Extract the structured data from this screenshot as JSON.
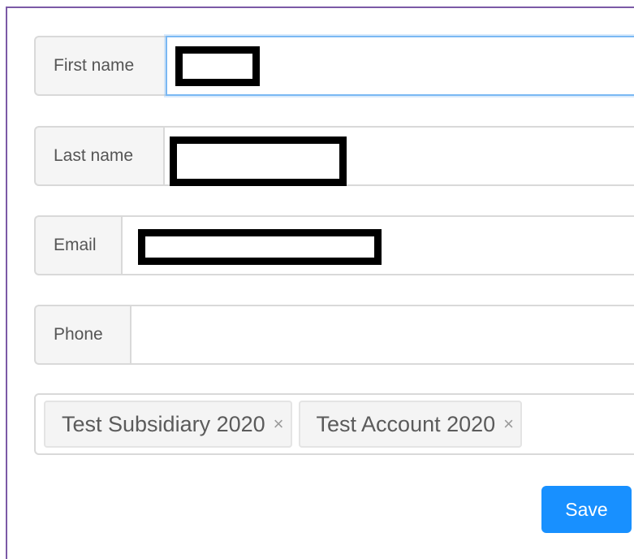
{
  "form": {
    "fields": [
      {
        "label": "First name",
        "value": "",
        "redacted": true
      },
      {
        "label": "Last name",
        "value": "",
        "redacted": true
      },
      {
        "label": "Email",
        "value": "",
        "redacted": true
      },
      {
        "label": "Phone",
        "value": "",
        "redacted": false
      }
    ],
    "tags": [
      {
        "label": "Test Subsidiary 2020",
        "close": "×"
      },
      {
        "label": "Test Account 2020",
        "close": "×"
      }
    ],
    "save_label": "Save"
  },
  "colors": {
    "accent": "#1890ff",
    "focus_border": "#7ab8f3",
    "frame": "#7b5aa6",
    "redaction": "#000000"
  }
}
